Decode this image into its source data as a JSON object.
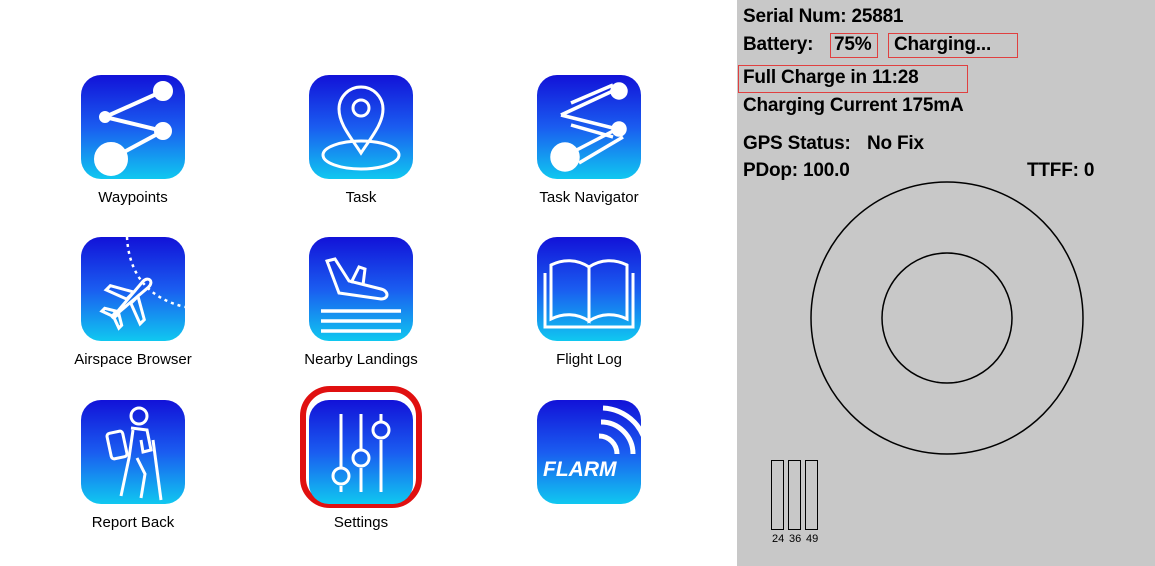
{
  "menu": {
    "items": [
      {
        "label": "Waypoints",
        "icon": "waypoints-icon"
      },
      {
        "label": "Task",
        "icon": "task-pin-icon"
      },
      {
        "label": "Task Navigator",
        "icon": "task-navigator-icon"
      },
      {
        "label": "Airspace Browser",
        "icon": "airspace-plane-icon"
      },
      {
        "label": "Nearby Landings",
        "icon": "landing-icon"
      },
      {
        "label": "Flight Log",
        "icon": "book-icon"
      },
      {
        "label": "Report Back",
        "icon": "hiker-icon"
      },
      {
        "label": "Settings",
        "icon": "sliders-icon",
        "selected": true
      },
      {
        "label": "",
        "icon": "flarm-icon",
        "logo_text": "FLARM"
      }
    ]
  },
  "gps_panel": {
    "serial": "Serial Num: 25881",
    "battery_label": "Battery:",
    "battery_percent": "75%",
    "battery_status": "Charging...",
    "full_charge": "Full Charge in 11:28",
    "charging_current": "Charging Current 175mA",
    "gps_status_label": "GPS Status:",
    "gps_status_value": "No Fix",
    "pdop": "PDop: 100.0",
    "ttff": "TTFF: 0",
    "satellite_bars": [
      {
        "label": "24",
        "level": 0
      },
      {
        "label": "36",
        "level": 0
      },
      {
        "label": "49",
        "level": 0
      }
    ]
  },
  "colors": {
    "tile_top": "#1212d8",
    "tile_bottom": "#10c8f0",
    "selected_ring": "#e01010",
    "panel_bg": "#c8c8c8",
    "highlight_box": "#e04040"
  }
}
